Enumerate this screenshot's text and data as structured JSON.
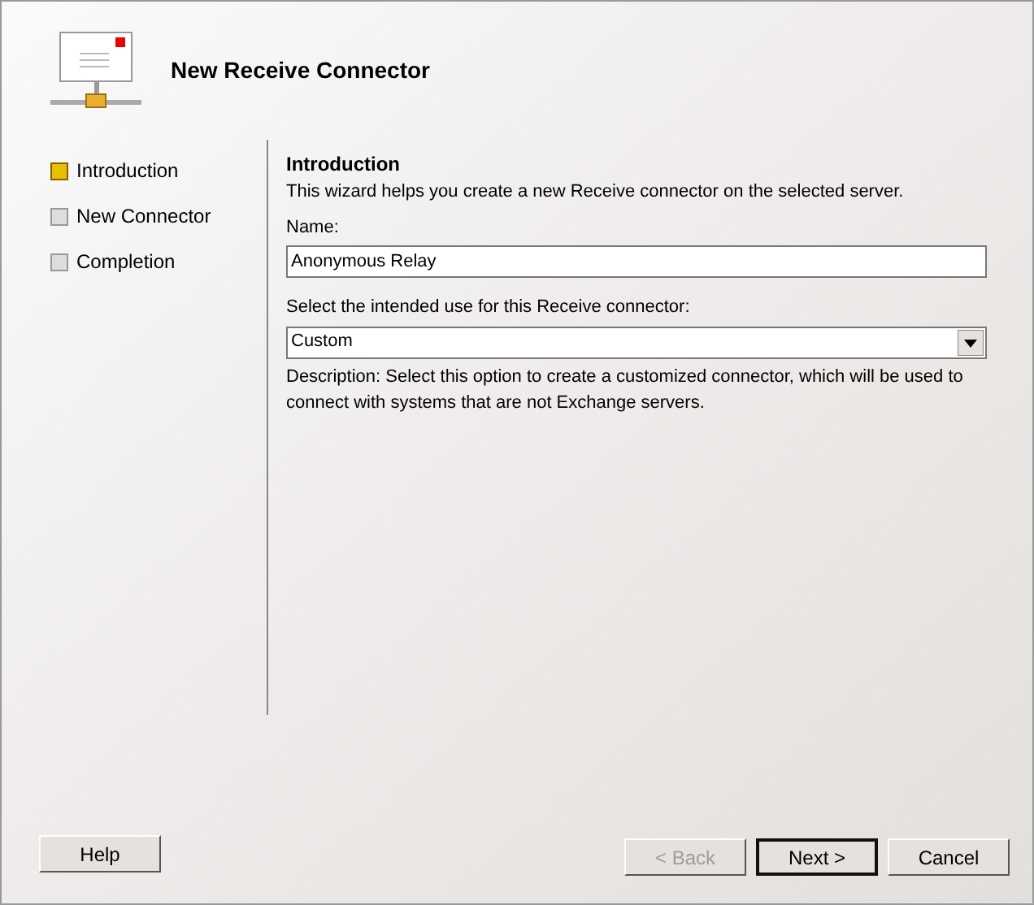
{
  "header": {
    "title": "New Receive Connector"
  },
  "steps": [
    {
      "label": "Introduction",
      "selected": true
    },
    {
      "label": "New Connector",
      "selected": false
    },
    {
      "label": "Completion",
      "selected": false
    }
  ],
  "page": {
    "heading": "Introduction",
    "intro": "This wizard helps you create a new Receive connector on the selected server.",
    "name_label": "Name:",
    "name_value": "Anonymous Relay",
    "use_label": "Select the intended use for this Receive connector:",
    "use_value": "Custom",
    "description": "Description: Select this option to create a customized connector, which will be used to connect with systems that are not Exchange servers."
  },
  "buttons": [
    {
      "label": "Help",
      "kind": "help",
      "disabled": false,
      "default": false
    },
    {
      "label": "< Back",
      "kind": "nav",
      "disabled": true,
      "default": false
    },
    {
      "label": "Next >",
      "kind": "nav",
      "disabled": false,
      "default": true
    },
    {
      "label": "Cancel",
      "kind": "nav",
      "disabled": false,
      "default": false
    }
  ]
}
